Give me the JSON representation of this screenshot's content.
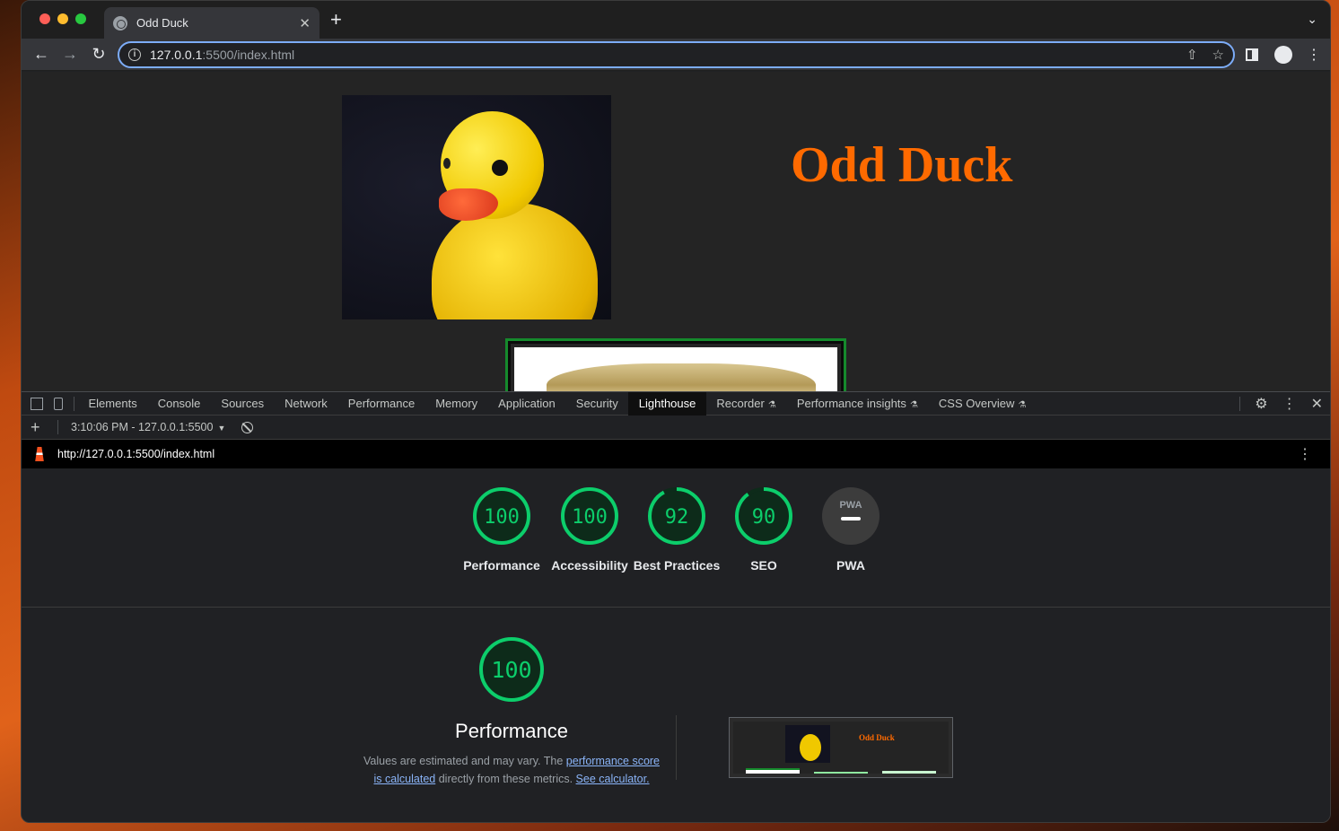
{
  "browser": {
    "tab": {
      "title": "Odd Duck",
      "close": "✕"
    },
    "new_tab": "+",
    "url_host": "127.0.0.1",
    "url_path": ":5500/index.html"
  },
  "page": {
    "heading": "Odd Duck"
  },
  "devtools": {
    "tabs": [
      "Elements",
      "Console",
      "Sources",
      "Network",
      "Performance",
      "Memory",
      "Application",
      "Security",
      "Lighthouse",
      "Recorder",
      "Performance insights",
      "CSS Overview"
    ],
    "active_tab": "Lighthouse",
    "report_selector": "3:10:06 PM - 127.0.0.1:5500",
    "report_url": "http://127.0.0.1:5500/index.html"
  },
  "lighthouse": {
    "colors": {
      "pass": "#0cce6b",
      "pass_text": "#0cce6b",
      "pwa_bg": "#3c3c3c"
    },
    "categories": [
      {
        "name": "Performance",
        "score": 100
      },
      {
        "name": "Accessibility",
        "score": 100
      },
      {
        "name": "Best Practices",
        "score": 92
      },
      {
        "name": "SEO",
        "score": 90
      },
      {
        "name": "PWA",
        "score": null,
        "badge": "PWA"
      }
    ],
    "main": {
      "score": "100",
      "title": "Performance",
      "desc_1": "Values are estimated and may vary. The ",
      "link_1": "performance score is calculated",
      "desc_2": " directly from these metrics. ",
      "link_2": "See calculator."
    },
    "thumbnail_title": "Odd Duck"
  }
}
